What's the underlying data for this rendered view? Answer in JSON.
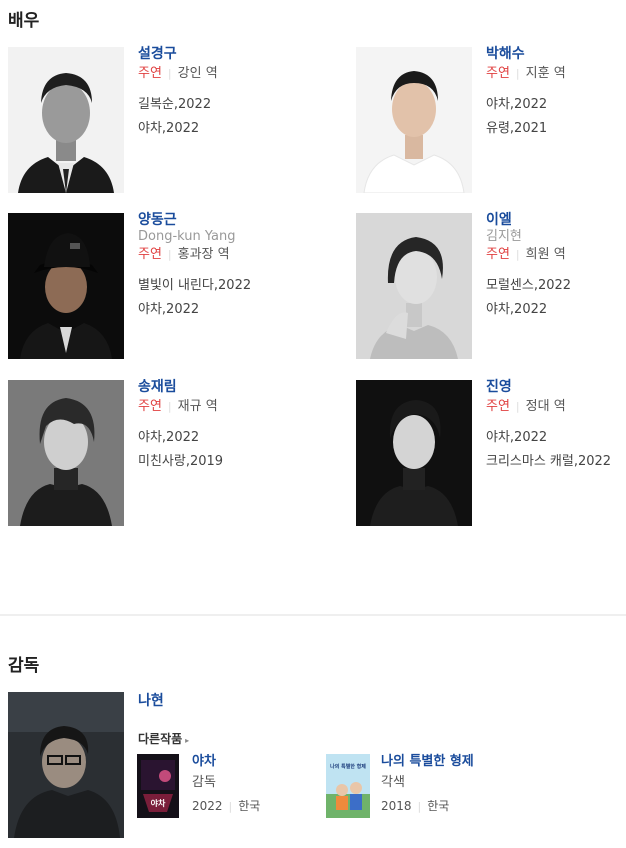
{
  "cast": {
    "heading": "배우",
    "actors": [
      {
        "name": "설경구",
        "alt_name": "",
        "role_type": "주연",
        "character": "강인 역",
        "works": [
          "길복순,2022",
          "야차,2022"
        ]
      },
      {
        "name": "박해수",
        "alt_name": "",
        "role_type": "주연",
        "character": "지훈 역",
        "works": [
          "야차,2022",
          "유령,2021"
        ]
      },
      {
        "name": "양동근",
        "alt_name": "Dong-kun Yang",
        "role_type": "주연",
        "character": "홍과장 역",
        "works": [
          "별빛이 내린다,2022",
          "야차,2022"
        ]
      },
      {
        "name": "이엘",
        "alt_name": "김지현",
        "role_type": "주연",
        "character": "희원 역",
        "works": [
          "모럴센스,2022",
          "야차,2022"
        ]
      },
      {
        "name": "송재림",
        "alt_name": "",
        "role_type": "주연",
        "character": "재규 역",
        "works": [
          "야차,2022",
          "미친사랑,2019"
        ]
      },
      {
        "name": "진영",
        "alt_name": "",
        "role_type": "주연",
        "character": "정대 역",
        "works": [
          "야차,2022",
          "크리스마스 캐럴,2022"
        ]
      }
    ]
  },
  "directing": {
    "heading": "감독",
    "director": {
      "name": "나현",
      "other_works_label": "다른작품",
      "films": [
        {
          "title": "야차",
          "role": "감독",
          "year": "2022",
          "country": "한국",
          "poster_text": "야차"
        },
        {
          "title": "나의 특별한 형제",
          "role": "각색",
          "year": "2018",
          "country": "한국",
          "poster_text": "나의 특별한 형제"
        }
      ]
    }
  }
}
